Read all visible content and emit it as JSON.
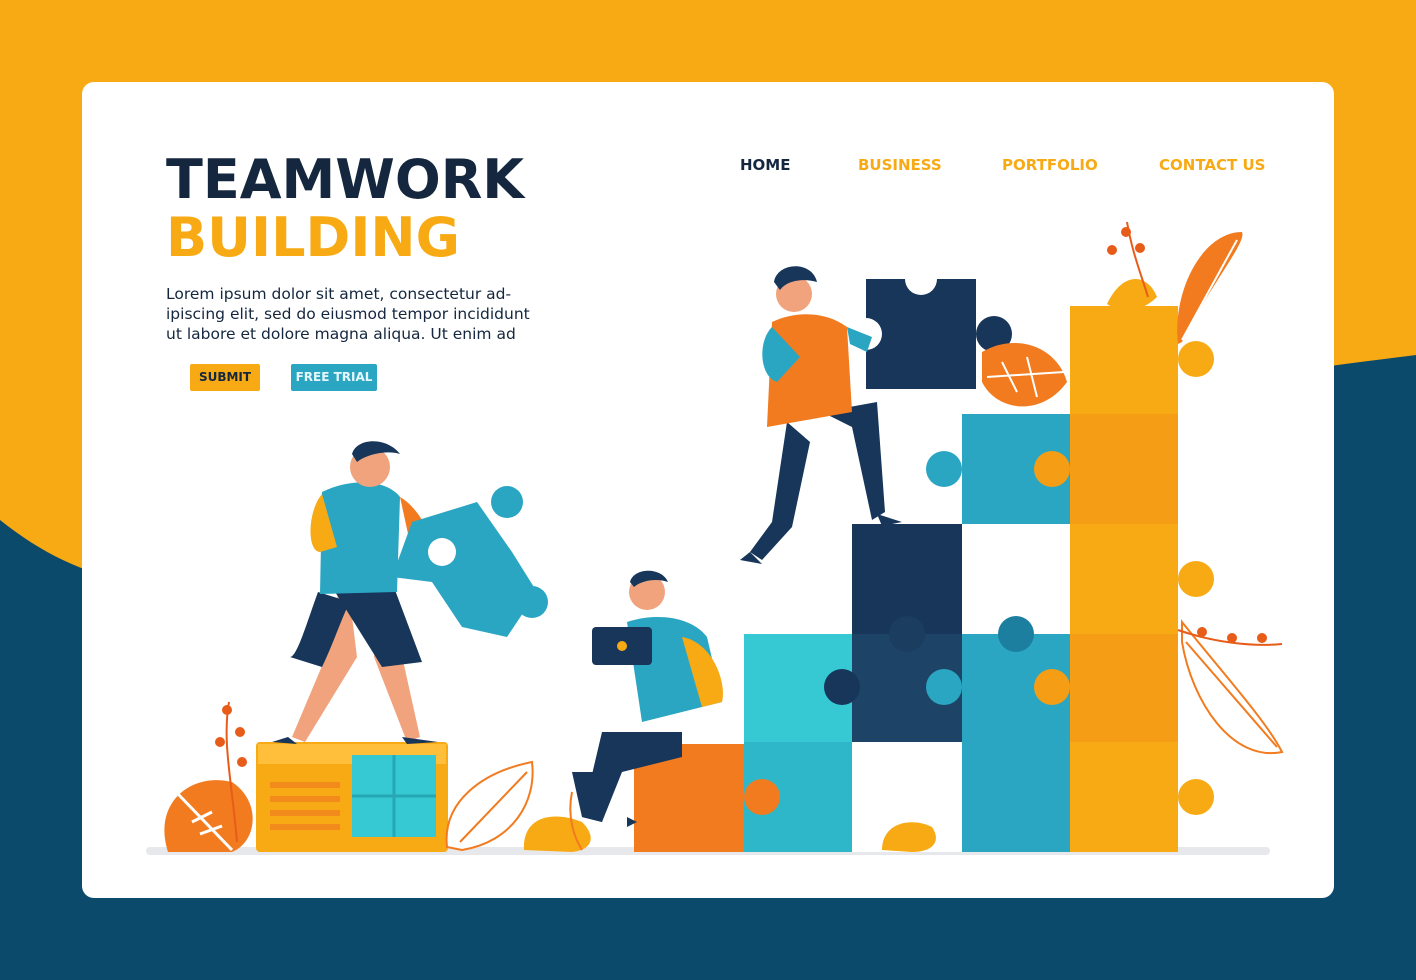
{
  "colors": {
    "brand_yellow": "#f7aa14",
    "brand_navy": "#14273f",
    "teal": "#2aa6c3",
    "orange": "#f27b1f",
    "background_dark": "#0b4a6b"
  },
  "nav": {
    "items": [
      {
        "label": "HOME",
        "active": true
      },
      {
        "label": "BUSINESS",
        "active": false
      },
      {
        "label": "PORTFOLIO",
        "active": false
      },
      {
        "label": "CONTACT US",
        "active": false
      }
    ]
  },
  "hero": {
    "title_line1": "TEAMWORK",
    "title_line2": "BUILDING",
    "description_lines": [
      "Lorem ipsum dolor sit amet, consectetur ad-",
      "ipiscing elit, sed do eiusmod tempor incididunt",
      "ut labore et dolore magna aliqua. Ut enim ad"
    ],
    "submit_label": "SUBMIT",
    "trial_label": "FREE TRIAL"
  },
  "illustration": {
    "icons": [
      "puzzle-piece-icon",
      "person-icon",
      "tablet-icon",
      "leaf-icon"
    ]
  }
}
